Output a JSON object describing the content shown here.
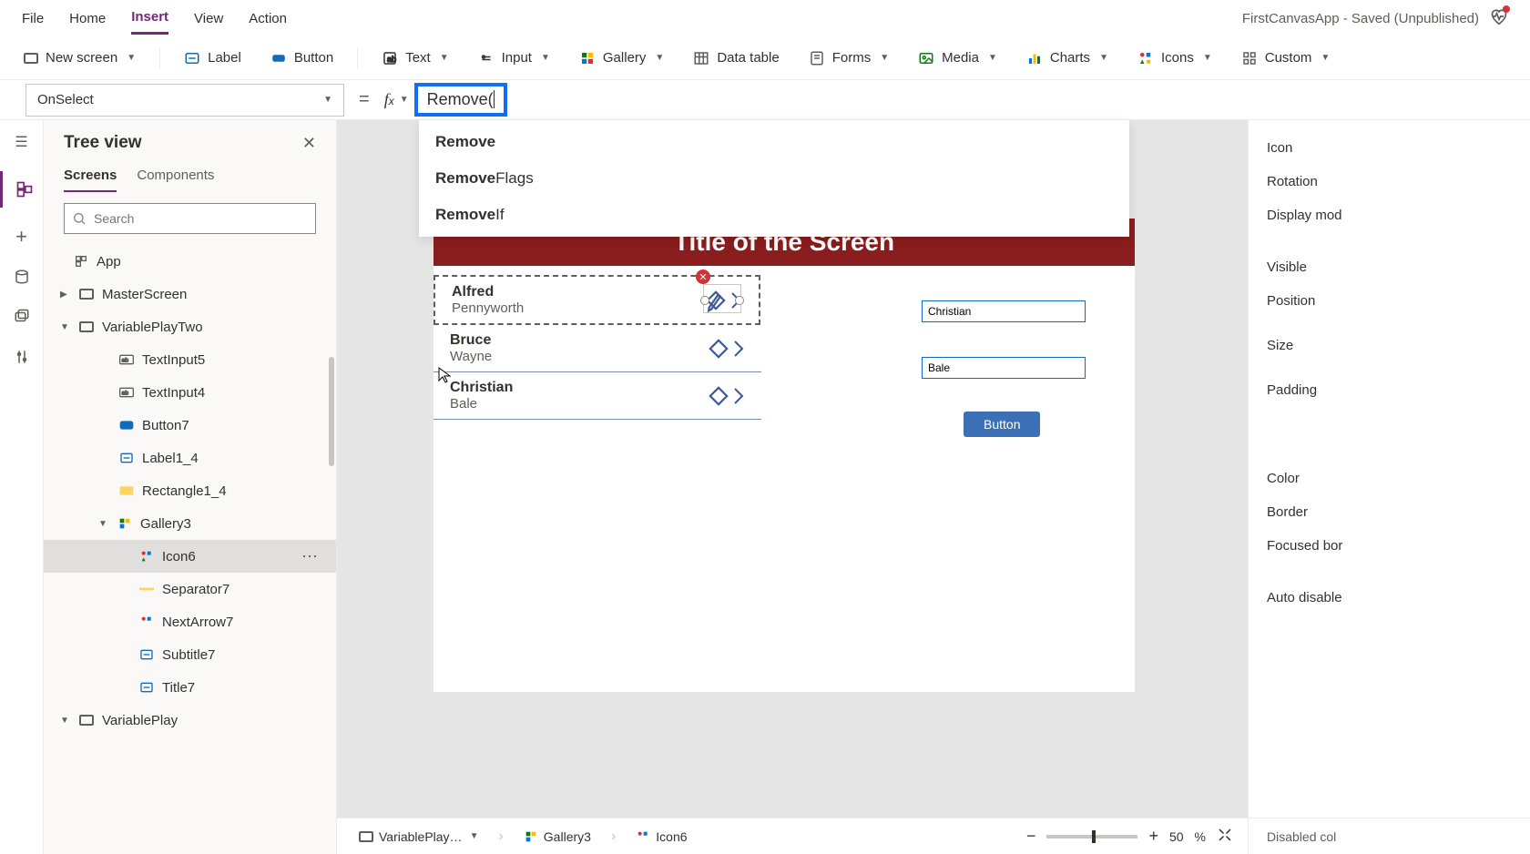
{
  "menubar": {
    "items": [
      "File",
      "Home",
      "Insert",
      "View",
      "Action"
    ],
    "active": "Insert",
    "app_title": "FirstCanvasApp - Saved (Unpublished)"
  },
  "ribbon": {
    "new_screen": "New screen",
    "label": "Label",
    "button": "Button",
    "text": "Text",
    "input": "Input",
    "gallery": "Gallery",
    "data_table": "Data table",
    "forms": "Forms",
    "media": "Media",
    "charts": "Charts",
    "icons": "Icons",
    "custom": "Custom"
  },
  "formula": {
    "property": "OnSelect",
    "text": "Remove(",
    "suggestions": [
      {
        "bold": "Remove",
        "rest": ""
      },
      {
        "bold": "Remove",
        "rest": "Flags"
      },
      {
        "bold": "Remove",
        "rest": "If"
      }
    ]
  },
  "treeview": {
    "title": "Tree view",
    "tabs": [
      "Screens",
      "Components"
    ],
    "search_placeholder": "Search",
    "nodes": {
      "app": "App",
      "master": "MasterScreen",
      "varplay2": "VariablePlayTwo",
      "ti5": "TextInput5",
      "ti4": "TextInput4",
      "btn7": "Button7",
      "lbl14": "Label1_4",
      "rect14": "Rectangle1_4",
      "gal3": "Gallery3",
      "icon6": "Icon6",
      "sep7": "Separator7",
      "next7": "NextArrow7",
      "sub7": "Subtitle7",
      "title7": "Title7",
      "varplay": "VariablePlay"
    }
  },
  "canvas": {
    "screen_title": "Title of the Screen",
    "gallery_items": [
      {
        "title": "Alfred",
        "subtitle": "Pennyworth"
      },
      {
        "title": "Bruce",
        "subtitle": "Wayne"
      },
      {
        "title": "Christian",
        "subtitle": "Bale"
      }
    ],
    "input1": "Christian",
    "input2": "Bale",
    "button_label": "Button"
  },
  "properties": {
    "rows": [
      "Icon",
      "Rotation",
      "Display mod",
      "Visible",
      "Position",
      "Size",
      "Padding",
      "Color",
      "Border",
      "Focused bor",
      "Auto disable"
    ]
  },
  "statusbar": {
    "crumb1": "VariablePlay…",
    "crumb2": "Gallery3",
    "crumb3": "Icon6",
    "zoom": "50",
    "pct": "%",
    "disabled": "Disabled col"
  }
}
